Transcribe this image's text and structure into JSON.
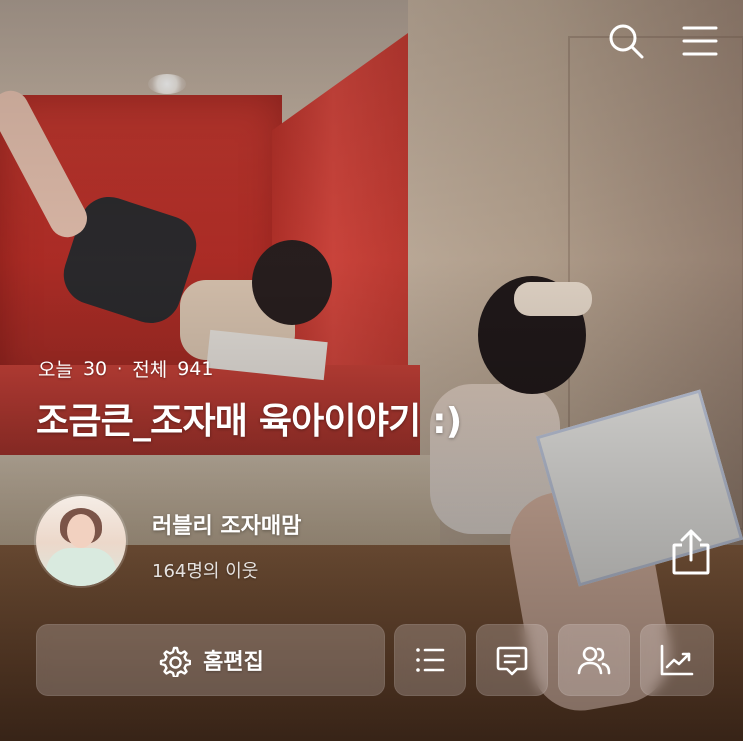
{
  "header": {
    "search_icon": "search-icon",
    "menu_icon": "menu-icon"
  },
  "blog": {
    "today_label": "오늘",
    "today_count": "30",
    "separator": "·",
    "total_label": "전체",
    "total_count": "941",
    "title": "조금큰_조자매 육아이야기 :)"
  },
  "profile": {
    "nickname": "러블리 조자매맘",
    "neighbors": "164명의 이웃"
  },
  "actions": {
    "home_edit_icon": "settings-icon",
    "home_edit_label": "홈편집",
    "list_icon": "list-icon",
    "comments_icon": "comment-icon",
    "neighbors_icon": "people-icon",
    "stats_icon": "stats-icon",
    "share_icon": "share-icon"
  },
  "colors": {
    "text": "#ffffff",
    "button_fill": "rgba(238,232,228,0.24)",
    "red_backdrop": "#c83a31"
  }
}
